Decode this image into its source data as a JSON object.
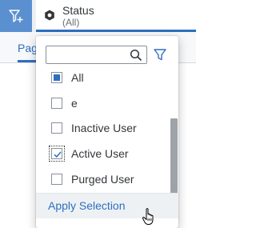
{
  "header": {
    "add_filter_icon": "add-filter-icon",
    "status_filter": {
      "title": "Status",
      "value": "(All)",
      "icon": "hexagon-status-icon"
    }
  },
  "tabs": [
    {
      "label": "Pag"
    }
  ],
  "popover": {
    "search": {
      "value": "",
      "placeholder": ""
    },
    "items": [
      {
        "label": "All",
        "state": "partial"
      },
      {
        "label": "e",
        "state": "unchecked"
      },
      {
        "label": "Inactive User",
        "state": "unchecked"
      },
      {
        "label": "Active User",
        "state": "checked"
      },
      {
        "label": "Purged User",
        "state": "unchecked"
      }
    ],
    "apply_label": "Apply Selection"
  },
  "colors": {
    "accent": "#2e6fc0",
    "add_filter_bg": "#5a8fd0",
    "apply_bg": "#eef1f4"
  }
}
